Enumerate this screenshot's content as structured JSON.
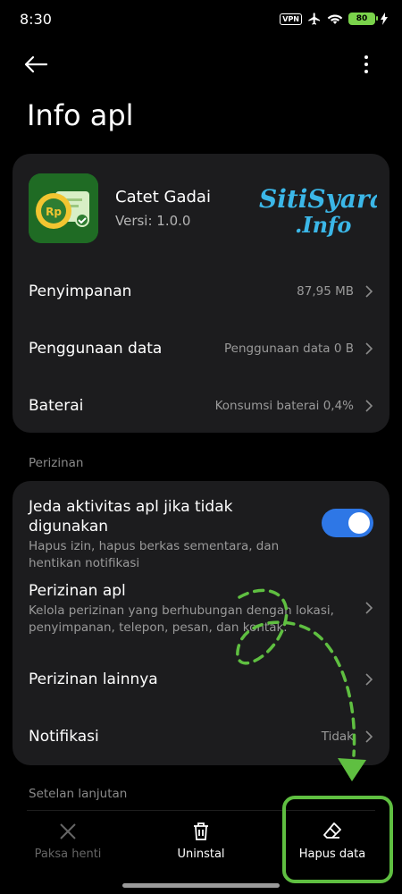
{
  "status_bar": {
    "time": "8:30",
    "vpn": "VPN",
    "battery": "80"
  },
  "header": {
    "title": "Info apl"
  },
  "app": {
    "name": "Catet Gadai",
    "version": "Versi: 1.0.0",
    "watermark": "SitiSyarah.Info"
  },
  "main_rows": [
    {
      "label": "Penyimpanan",
      "value": "87,95 MB"
    },
    {
      "label": "Penggunaan data",
      "value": "Penggunaan data 0 B"
    },
    {
      "label": "Baterai",
      "value": "Konsumsi baterai 0,4%"
    }
  ],
  "permissions": {
    "section_label": "Perizinan",
    "pause": {
      "title": "Jeda aktivitas apl jika tidak digunakan",
      "desc": "Hapus izin, hapus berkas sementara, dan hentikan notifikasi",
      "enabled": true
    },
    "app_perms": {
      "title": "Perizinan apl",
      "desc": "Kelola perizinan yang berhubungan dengan lokasi, penyimpanan, telepon, pesan, dan kontak."
    },
    "other": {
      "title": "Perizinan lainnya"
    },
    "notif": {
      "title": "Notifikasi",
      "value": "Tidak"
    }
  },
  "advanced": {
    "section_label": "Setelan lanjutan"
  },
  "bottom_bar": {
    "force_stop": "Paksa henti",
    "uninstall": "Uninstal",
    "clear_data": "Hapus data"
  },
  "colors": {
    "accent": "#2e77e6",
    "annotation": "#5fbf41",
    "card": "#1c1c1e"
  }
}
